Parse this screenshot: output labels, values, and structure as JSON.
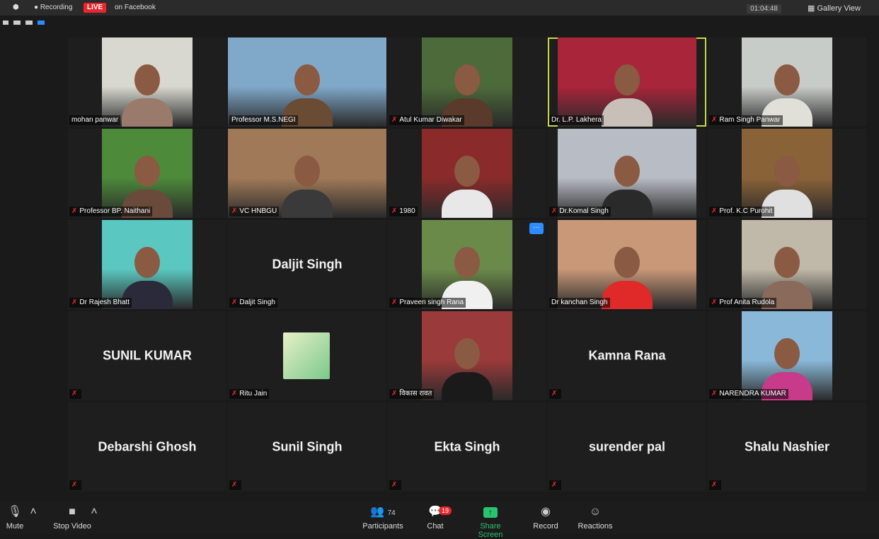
{
  "topbar": {
    "recording": "Recording",
    "live": "LIVE",
    "on_facebook": "on Facebook",
    "timer": "01:04:48",
    "gallery_view": "Gallery View"
  },
  "tiles": [
    {
      "name": "mohan panwar",
      "muted": false,
      "video": true,
      "bg": "#d8d8d0",
      "fg": "#9a7a6a"
    },
    {
      "name": "Professor M.S.NEGI",
      "muted": false,
      "video": true,
      "bg": "#7fa8c9",
      "fg": "#6a4b33"
    },
    {
      "name": "Atul Kumar Diwakar",
      "muted": true,
      "video": true,
      "bg": "#4d6a3a",
      "fg": "#5a3a2a"
    },
    {
      "name": "Dr. L.P. Lakhera",
      "muted": false,
      "video": true,
      "bg": "#a8253a",
      "fg": "#c8c0b8",
      "active": true
    },
    {
      "name": "Ram Singh Panwar",
      "muted": true,
      "video": true,
      "bg": "#c8ccc8",
      "fg": "#e0e0d8"
    },
    {
      "name": "Professor BP. Naithani",
      "muted": true,
      "video": true,
      "bg": "#4d8a3a",
      "fg": "#6a4a3a"
    },
    {
      "name": "VC HNBGU",
      "muted": true,
      "video": true,
      "bg": "#a07a58",
      "fg": "#3a3a3a"
    },
    {
      "name": "1980",
      "muted": true,
      "video": true,
      "bg": "#8a2a2a",
      "fg": "#e8e8e8"
    },
    {
      "name": "Dr.Komal Singh",
      "muted": true,
      "video": true,
      "bg": "#b8bcc4",
      "fg": "#2a2a2a"
    },
    {
      "name": "Prof. K.C Purohit",
      "muted": true,
      "video": true,
      "bg": "#8a6238",
      "fg": "#e0e0e0"
    },
    {
      "name": "Dr Rajesh Bhatt",
      "muted": true,
      "video": true,
      "bg": "#5ac8c0",
      "fg": "#2a2a3a"
    },
    {
      "name": "Daljit Singh",
      "muted": true,
      "video": false
    },
    {
      "name": "Praveen singh Rana",
      "muted": true,
      "video": true,
      "bg": "#6a8a4a",
      "fg": "#f0f0f0",
      "dots": true
    },
    {
      "name": "Dr kanchan  Singh",
      "muted": false,
      "video": true,
      "bg": "#c89878",
      "fg": "#e02a2a"
    },
    {
      "name": "Prof Anita Rudola",
      "muted": true,
      "video": true,
      "bg": "#c0b8a8",
      "fg": "#8a6a5a"
    },
    {
      "name": "SUNIL KUMAR",
      "muted": true,
      "video": false,
      "noname": true
    },
    {
      "name": "Ritu Jain",
      "muted": true,
      "video": false,
      "avatar": true
    },
    {
      "name": "विकास रावत",
      "muted": true,
      "video": true,
      "bg": "#9a3a3a",
      "fg": "#1a1a1a"
    },
    {
      "name": "Kamna Rana",
      "muted": true,
      "video": false,
      "noname": true
    },
    {
      "name": "NARENDRA KUMAR",
      "muted": true,
      "video": true,
      "bg": "#8ab8d8",
      "fg": "#c83a8a"
    },
    {
      "name": "Debarshi Ghosh",
      "muted": true,
      "video": false,
      "noname": true
    },
    {
      "name": "Sunil Singh",
      "muted": true,
      "video": false,
      "noname": true
    },
    {
      "name": "Ekta Singh",
      "muted": true,
      "video": false,
      "noname": true
    },
    {
      "name": "surender pal",
      "muted": true,
      "video": false,
      "noname": true
    },
    {
      "name": "Shalu Nashier",
      "muted": true,
      "video": false,
      "noname": true
    }
  ],
  "bottombar": {
    "mute": "Mute",
    "stop_video": "Stop Video",
    "participants": "Participants",
    "participants_count": "74",
    "chat": "Chat",
    "chat_badge": "19",
    "share_screen": "Share Screen",
    "record": "Record",
    "reactions": "Reactions"
  },
  "colors": {
    "accent": "#2d8cff",
    "share": "#29c46f",
    "live": "#e8262d",
    "active_border": "#c8d84a"
  }
}
